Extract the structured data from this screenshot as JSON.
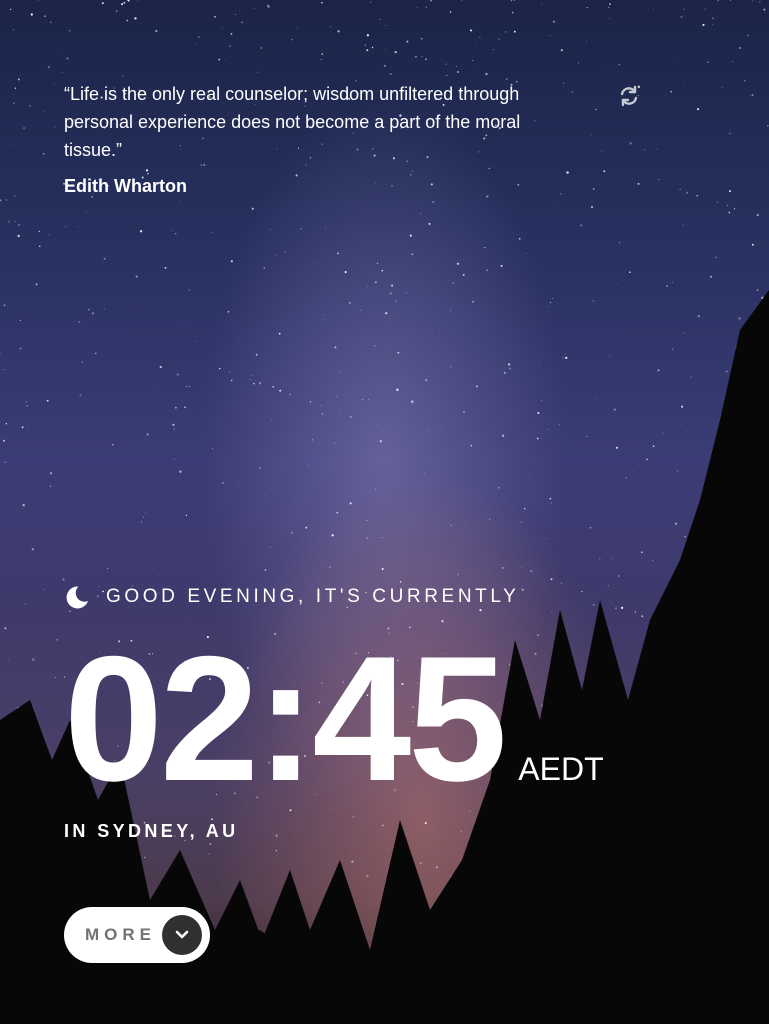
{
  "quote": {
    "text": "“Life is the only real counselor; wisdom unfiltered through personal experience does not become a part of the moral tissue.”",
    "author": "Edith Wharton",
    "refresh_icon": "refresh-icon"
  },
  "greeting": {
    "icon": "moon-icon",
    "text": "GOOD EVENING, IT'S CURRENTLY"
  },
  "clock": {
    "time": "02:45",
    "timezone": "AEDT"
  },
  "location": {
    "text": "IN SYDNEY, AU"
  },
  "more_button": {
    "label": "MORE",
    "icon": "chevron-down-icon"
  },
  "colors": {
    "text": "#ffffff",
    "button_bg": "#ffffff",
    "button_text": "#727272",
    "chevron_bg": "#303030"
  }
}
